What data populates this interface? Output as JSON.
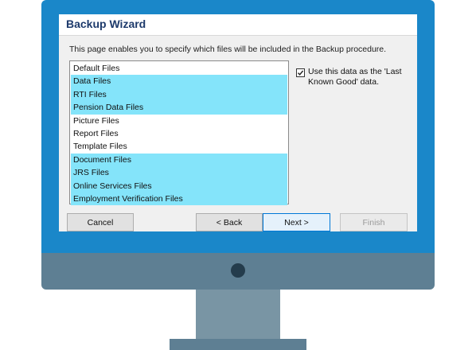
{
  "wizard": {
    "title": "Backup Wizard",
    "description": "This page enables you to specify which files will be included in the Backup procedure."
  },
  "file_list": {
    "items": [
      {
        "label": "Default Files",
        "selected": false
      },
      {
        "label": "Data Files",
        "selected": true
      },
      {
        "label": "RTI Files",
        "selected": true
      },
      {
        "label": "Pension Data Files",
        "selected": true
      },
      {
        "label": "Picture Files",
        "selected": false
      },
      {
        "label": "Report Files",
        "selected": false
      },
      {
        "label": "Template Files",
        "selected": false
      },
      {
        "label": "Document Files",
        "selected": true
      },
      {
        "label": "JRS Files",
        "selected": true
      },
      {
        "label": "Online Services Files",
        "selected": true
      },
      {
        "label": "Employment Verification Files",
        "selected": true
      }
    ]
  },
  "last_known_good": {
    "label": "Use this data as the 'Last Known Good' data.",
    "checked": true
  },
  "buttons": {
    "cancel": "Cancel",
    "back": "< Back",
    "next": "Next >",
    "finish": "Finish"
  },
  "colors": {
    "selection": "#84e4fa",
    "monitor_frame": "#1a87c9",
    "title_text": "#1d3a6b"
  }
}
